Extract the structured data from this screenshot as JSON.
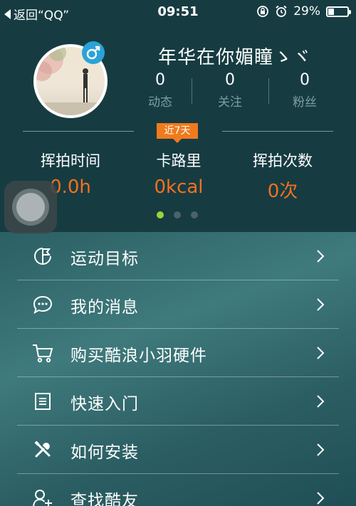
{
  "status_bar": {
    "back_label": "返回“QQ”",
    "time": "09:51",
    "battery": "29%",
    "battery_level": 0.29
  },
  "profile": {
    "username": "年华在你媚瞳ゝヾ",
    "gender_icon": "male-icon",
    "stats": [
      {
        "value": "0",
        "label": "动态"
      },
      {
        "value": "0",
        "label": "关注"
      },
      {
        "value": "0",
        "label": "粉丝"
      }
    ]
  },
  "period_badge": "近7天",
  "metrics": [
    {
      "label": "挥拍时间",
      "value": "0.0h"
    },
    {
      "label": "卡路里",
      "value": "0kcal"
    },
    {
      "label": "挥拍次数",
      "value": "0次"
    }
  ],
  "pager": {
    "count": 3,
    "active": 0
  },
  "menu": {
    "items": [
      {
        "label": "运动目标",
        "icon": "goal-flag-icon"
      },
      {
        "label": "我的消息",
        "icon": "chat-bubble-icon"
      },
      {
        "label": "购买酷浪小羽硬件",
        "icon": "shopping-cart-icon"
      },
      {
        "label": "快速入门",
        "icon": "document-list-icon"
      },
      {
        "label": "如何安装",
        "icon": "tools-icon"
      },
      {
        "label": "查找酷友",
        "icon": "add-friend-icon"
      }
    ]
  },
  "colors": {
    "accent_orange": "#f4701e",
    "header_bg": "#163c42",
    "active_dot": "#9bd33a",
    "gender_badge": "#2aa3d8"
  }
}
